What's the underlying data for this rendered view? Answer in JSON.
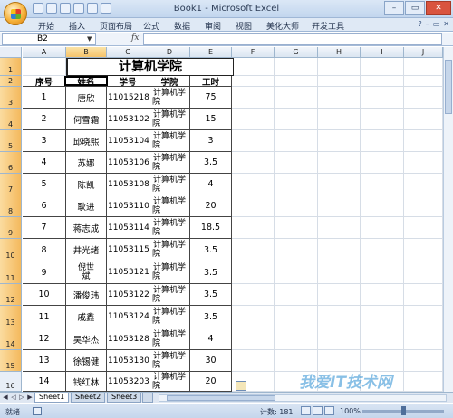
{
  "window": {
    "title": "Book1 - Microsoft Excel"
  },
  "ribbon_tabs": [
    "开始",
    "插入",
    "页面布局",
    "公式",
    "数据",
    "审阅",
    "视图",
    "美化大师",
    "开发工具"
  ],
  "formula_bar": {
    "name_box": "B2",
    "fx": "fx",
    "formula": ""
  },
  "columns": [
    "A",
    "B",
    "C",
    "D",
    "E",
    "F",
    "G",
    "H",
    "I",
    "J"
  ],
  "rows": [
    "1",
    "2",
    "3",
    "4",
    "5",
    "6",
    "7",
    "8",
    "9",
    "10",
    "11",
    "12",
    "13",
    "14",
    "15",
    "16"
  ],
  "table": {
    "title": "计算机学院",
    "headers": [
      "序号",
      "姓名",
      "学号",
      "学院",
      "工时"
    ],
    "rows": [
      {
        "no": "1",
        "name": "唐欣",
        "id": "11015218",
        "college": [
          "计算机学",
          "院"
        ],
        "hours": "75"
      },
      {
        "no": "2",
        "name": "何雪霜",
        "id": "11053102",
        "college": [
          "计算机学",
          "院"
        ],
        "hours": "15"
      },
      {
        "no": "3",
        "name": "邱晓熙",
        "id": "11053104",
        "college": [
          "计算机学",
          "院"
        ],
        "hours": "3"
      },
      {
        "no": "4",
        "name": "苏娜",
        "id": "11053106",
        "college": [
          "计算机学",
          "院"
        ],
        "hours": "3.5"
      },
      {
        "no": "5",
        "name": "陈凯",
        "id": "11053108",
        "college": [
          "计算机学",
          "院"
        ],
        "hours": "4"
      },
      {
        "no": "6",
        "name": "耿进",
        "id": "11053110",
        "college": [
          "计算机学",
          "院"
        ],
        "hours": "20"
      },
      {
        "no": "7",
        "name": "蒋志成",
        "id": "11053114",
        "college": [
          "计算机学",
          "院"
        ],
        "hours": "18.5"
      },
      {
        "no": "8",
        "name": "井光绪",
        "id": "11053115",
        "college": [
          "计算机学",
          "院"
        ],
        "hours": "3.5"
      },
      {
        "no": "9",
        "name": [
          "倪世",
          "斌"
        ],
        "id": "11053121",
        "college": [
          "计算机学",
          "院"
        ],
        "hours": "3.5"
      },
      {
        "no": "10",
        "name": "潘俊玮",
        "id": "11053122",
        "college": [
          "计算机学",
          "院"
        ],
        "hours": "3.5"
      },
      {
        "no": "11",
        "name": "戚鑫",
        "id": "11053124",
        "college": [
          "计算机学",
          "院"
        ],
        "hours": "3.5"
      },
      {
        "no": "12",
        "name": "吴华杰",
        "id": "11053128",
        "college": [
          "计算机学",
          "院"
        ],
        "hours": "4"
      },
      {
        "no": "13",
        "name": "徐锡健",
        "id": "11053130",
        "college": [
          "计算机学",
          "院"
        ],
        "hours": "30"
      },
      {
        "no": "14",
        "name": "钱红林",
        "id": "11053203",
        "college": [
          "计算机学",
          "院"
        ],
        "hours": "20"
      }
    ]
  },
  "sheet_tabs": [
    "Sheet1",
    "Sheet2",
    "Sheet3"
  ],
  "status": {
    "mode": "就绪",
    "count": "计数: 181",
    "zoom": "100%"
  },
  "watermark": "我爱IT技术网"
}
